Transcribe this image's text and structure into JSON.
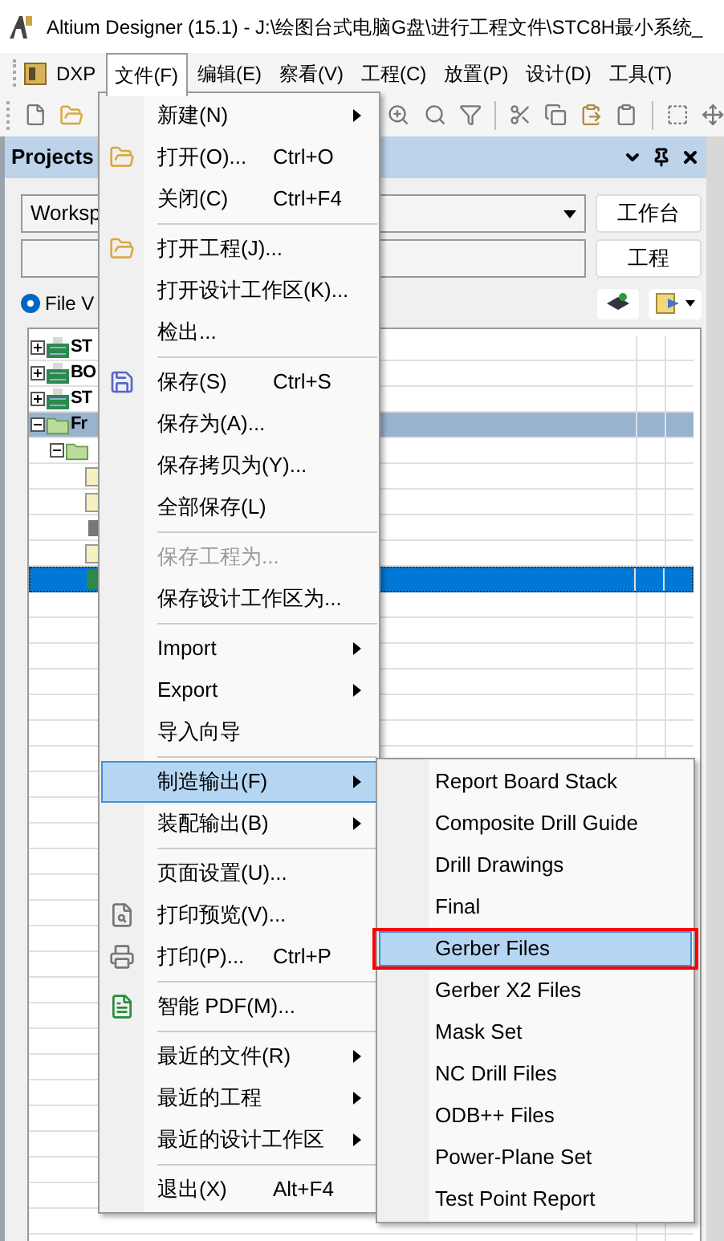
{
  "window": {
    "title": "Altium Designer (15.1) - J:\\绘图台式电脑G盘\\进行工程文件\\STC8H最小系统_"
  },
  "menubar": [
    {
      "label": "DXP",
      "kind": "logo",
      "selected": false
    },
    {
      "label": "文件(F)",
      "kind": "menu",
      "selected": true
    },
    {
      "label": "编辑(E)",
      "kind": "menu",
      "selected": false
    },
    {
      "label": "察看(V)",
      "kind": "menu",
      "selected": false
    },
    {
      "label": "工程(C)",
      "kind": "menu",
      "selected": false
    },
    {
      "label": "放置(P)",
      "kind": "menu",
      "selected": false
    },
    {
      "label": "设计(D)",
      "kind": "menu",
      "selected": false
    },
    {
      "label": "工具(T)",
      "kind": "menu",
      "selected": false
    }
  ],
  "panel": {
    "title": "Projects",
    "workspace": "Worksp",
    "workspace_button": "工作台",
    "project_button": "工程",
    "view_option": {
      "label": "File V",
      "selected": true
    },
    "tree": [
      {
        "label": "ST",
        "kind": "project",
        "expanded": false,
        "selected": false,
        "focused": false
      },
      {
        "label": "BO",
        "kind": "project",
        "expanded": false,
        "selected": false,
        "focused": false
      },
      {
        "label": "ST",
        "kind": "project",
        "expanded": false,
        "selected": false,
        "focused": false
      },
      {
        "label": "Fr",
        "kind": "folder",
        "expanded": true,
        "selected": true,
        "focused": false,
        "children": [
          {
            "kind": "folder",
            "expanded": true,
            "selected": false,
            "focused": false,
            "children": [
              {
                "kind": "document",
                "selected": false,
                "focused": false
              },
              {
                "kind": "document",
                "selected": false,
                "focused": false
              },
              {
                "kind": "library",
                "selected": false,
                "focused": false
              },
              {
                "kind": "document",
                "selected": false,
                "focused": false
              },
              {
                "kind": "pcb",
                "selected": true,
                "focused": true
              }
            ]
          }
        ]
      }
    ]
  },
  "file_menu": [
    {
      "kind": "item",
      "label": "新建(N)",
      "submenu": true,
      "disabled": false,
      "selected": false
    },
    {
      "kind": "item",
      "label": "打开(O)...",
      "shortcut": "Ctrl+O",
      "submenu": false,
      "disabled": false,
      "selected": false
    },
    {
      "kind": "item",
      "label": "关闭(C)",
      "shortcut": "Ctrl+F4",
      "submenu": false,
      "disabled": false,
      "selected": false
    },
    {
      "kind": "separator"
    },
    {
      "kind": "item",
      "label": "打开工程(J)...",
      "submenu": false,
      "disabled": false,
      "selected": false
    },
    {
      "kind": "item",
      "label": "打开设计工作区(K)...",
      "submenu": false,
      "disabled": false,
      "selected": false
    },
    {
      "kind": "item",
      "label": "检出...",
      "submenu": false,
      "disabled": false,
      "selected": false
    },
    {
      "kind": "separator"
    },
    {
      "kind": "item",
      "label": "保存(S)",
      "shortcut": "Ctrl+S",
      "submenu": false,
      "disabled": false,
      "selected": false
    },
    {
      "kind": "item",
      "label": "保存为(A)...",
      "submenu": false,
      "disabled": false,
      "selected": false
    },
    {
      "kind": "item",
      "label": "保存拷贝为(Y)...",
      "submenu": false,
      "disabled": false,
      "selected": false
    },
    {
      "kind": "item",
      "label": "全部保存(L)",
      "submenu": false,
      "disabled": false,
      "selected": false
    },
    {
      "kind": "separator"
    },
    {
      "kind": "item",
      "label": "保存工程为...",
      "submenu": false,
      "disabled": true,
      "selected": false
    },
    {
      "kind": "item",
      "label": "保存设计工作区为...",
      "submenu": false,
      "disabled": false,
      "selected": false
    },
    {
      "kind": "separator"
    },
    {
      "kind": "item",
      "label": "Import",
      "submenu": true,
      "disabled": false,
      "selected": false
    },
    {
      "kind": "item",
      "label": "Export",
      "submenu": true,
      "disabled": false,
      "selected": false
    },
    {
      "kind": "item",
      "label": "导入向导",
      "submenu": false,
      "disabled": false,
      "selected": false
    },
    {
      "kind": "separator"
    },
    {
      "kind": "item",
      "label": "制造输出(F)",
      "submenu": true,
      "disabled": false,
      "selected": true
    },
    {
      "kind": "item",
      "label": "装配输出(B)",
      "submenu": true,
      "disabled": false,
      "selected": false
    },
    {
      "kind": "separator"
    },
    {
      "kind": "item",
      "label": "页面设置(U)...",
      "submenu": false,
      "disabled": false,
      "selected": false
    },
    {
      "kind": "item",
      "label": "打印预览(V)...",
      "submenu": false,
      "disabled": false,
      "selected": false
    },
    {
      "kind": "item",
      "label": "打印(P)...",
      "shortcut": "Ctrl+P",
      "submenu": false,
      "disabled": false,
      "selected": false
    },
    {
      "kind": "separator"
    },
    {
      "kind": "item",
      "label": "智能 PDF(M)...",
      "submenu": false,
      "disabled": false,
      "selected": false
    },
    {
      "kind": "separator"
    },
    {
      "kind": "item",
      "label": "最近的文件(R)",
      "submenu": true,
      "disabled": false,
      "selected": false
    },
    {
      "kind": "item",
      "label": "最近的工程",
      "submenu": true,
      "disabled": false,
      "selected": false
    },
    {
      "kind": "item",
      "label": "最近的设计工作区",
      "submenu": true,
      "disabled": false,
      "selected": false
    },
    {
      "kind": "separator"
    },
    {
      "kind": "item",
      "label": "退出(X)",
      "shortcut": "Alt+F4",
      "submenu": false,
      "disabled": false,
      "selected": false
    }
  ],
  "fabrication_menu": [
    {
      "label": "Report Board Stack",
      "selected": false,
      "outlined": false
    },
    {
      "label": "Composite Drill Guide",
      "selected": false,
      "outlined": false
    },
    {
      "label": "Drill Drawings",
      "selected": false,
      "outlined": false
    },
    {
      "label": "Final",
      "selected": false,
      "outlined": false
    },
    {
      "label": "Gerber Files",
      "selected": true,
      "outlined": true
    },
    {
      "label": "Gerber X2 Files",
      "selected": false,
      "outlined": false
    },
    {
      "label": "Mask Set",
      "selected": false,
      "outlined": false
    },
    {
      "label": "NC Drill Files",
      "selected": false,
      "outlined": false
    },
    {
      "label": "ODB++ Files",
      "selected": false,
      "outlined": false
    },
    {
      "label": "Power-Plane Set",
      "selected": false,
      "outlined": false
    },
    {
      "label": "Test Point Report",
      "selected": false,
      "outlined": false
    }
  ]
}
